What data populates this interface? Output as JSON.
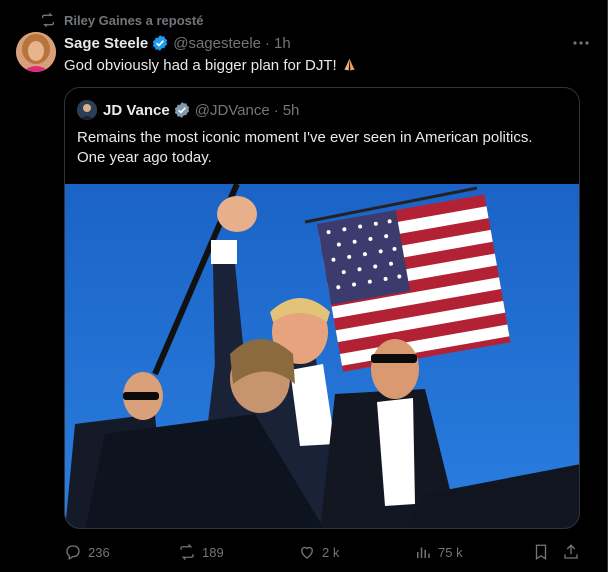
{
  "repost": {
    "text": "Riley Gaines a reposté"
  },
  "post": {
    "author_name": "Sage Steele",
    "handle": "@sagesteele",
    "separator": "·",
    "time": "1h",
    "text": "God obviously had a bigger plan for DJT!",
    "emoji": "folded-hands",
    "verified": true
  },
  "quoted_post": {
    "author_name": "JD Vance",
    "handle": "@JDVance",
    "separator": "·",
    "time": "5h",
    "text_line1": "Remains the most iconic moment I've ever seen in American politics.",
    "text_line2": "One year ago today.",
    "verified_badge": "gray-check",
    "image": "photo-raised-fist-flag"
  },
  "actions": {
    "replies": "236",
    "reposts": "189",
    "likes": "2 k",
    "views": "75 k"
  },
  "colors": {
    "background": "#000000",
    "text": "#e7e9ea",
    "muted": "#71767b",
    "verified_blue": "#1d9bf0",
    "border": "#2f3336",
    "sky": "#1f6fd1"
  }
}
